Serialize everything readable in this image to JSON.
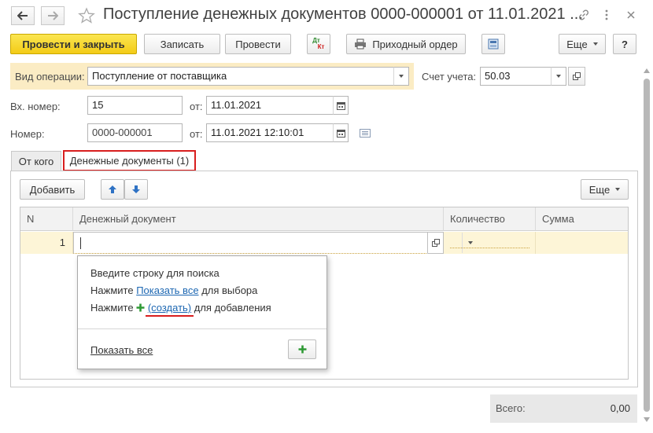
{
  "window": {
    "title": "Поступление денежных документов 0000-000001 от 11.01.2021 ...",
    "back_icon": "arrow-left-icon",
    "forward_icon": "arrow-right-icon",
    "favorite_icon": "star-icon",
    "link_icon": "link-icon",
    "more_icon": "more-vertical-icon",
    "close_icon": "close-icon"
  },
  "toolbar": {
    "post_close_label": "Провести и закрыть",
    "save_label": "Записать",
    "post_label": "Провести",
    "dt_label": "Дт",
    "kt_label": "Кт",
    "receipt_order_label": "Приходный ордер",
    "more_label": "Еще",
    "help_label": "?"
  },
  "form": {
    "operation_label": "Вид операции:",
    "operation_value": "Поступление от поставщика",
    "account_label": "Счет учета:",
    "account_value": "50.03",
    "in_number_label": "Вх. номер:",
    "in_number_value": "15",
    "from_label": "от:",
    "in_date_value": "11.01.2021",
    "number_label": "Номер:",
    "number_value": "0000-000001",
    "date_value": "11.01.2021 12:10:01"
  },
  "tabs": [
    {
      "label": "От кого"
    },
    {
      "label": "Денежные документы (1)"
    }
  ],
  "table_toolbar": {
    "add_label": "Добавить",
    "more_label": "Еще"
  },
  "table": {
    "columns": [
      "N",
      "Денежный документ",
      "Количество",
      "Сумма"
    ],
    "rows": [
      {
        "n": "1",
        "document": "",
        "quantity": "",
        "sum": ""
      }
    ]
  },
  "popup": {
    "line1": "Введите строку для поиска",
    "line2_prefix": "Нажмите",
    "line2_link": "Показать все",
    "line2_suffix": "для выбора",
    "line3_prefix": "Нажмите",
    "line3_link": "(создать)",
    "line3_suffix": "для добавления",
    "show_all_link": "Показать все",
    "add_icon": "plus-icon"
  },
  "footer": {
    "total_label": "Всего:",
    "total_value": "0,00"
  },
  "colors": {
    "primary_button": "#f3cb17",
    "highlight_band": "#fbecc4",
    "row_selected": "#fdf5d7",
    "link": "#1d67b2",
    "annotation_red": "#d81e1e",
    "plus_green": "#2f9a35"
  }
}
